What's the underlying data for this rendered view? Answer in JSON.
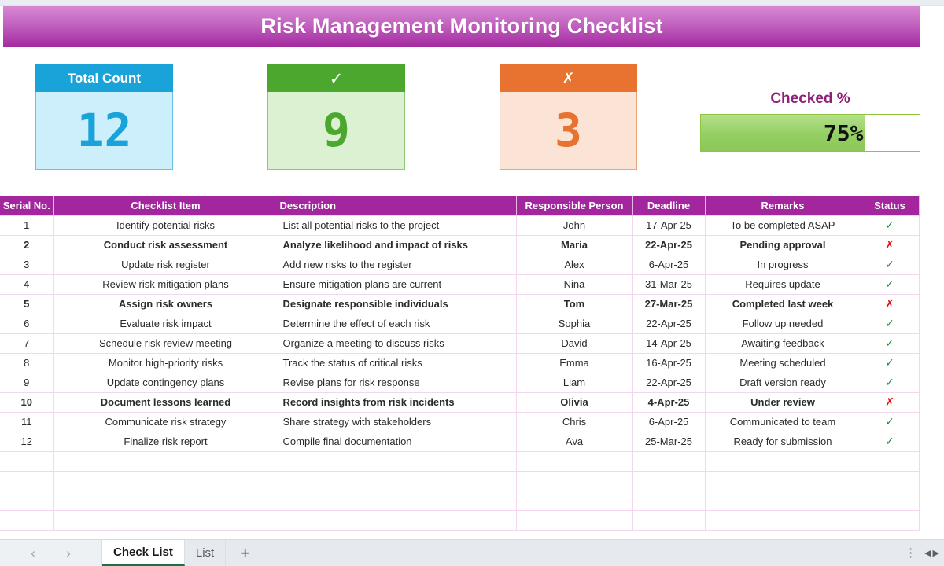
{
  "header": {
    "title": "Risk Management Monitoring Checklist"
  },
  "kpi": {
    "total": {
      "label": "Total Count",
      "value": "12"
    },
    "checked": {
      "label": "✓",
      "value": "9"
    },
    "unchecked": {
      "label": "✗",
      "value": "3"
    }
  },
  "gauge": {
    "label": "Checked %",
    "value": "75%",
    "percent": 75
  },
  "table": {
    "columns": [
      "Serial No.",
      "Checklist Item",
      "Description",
      "Responsible Person",
      "Deadline",
      "Remarks",
      "Status"
    ],
    "rows": [
      {
        "serial": "1",
        "item": "Identify potential risks",
        "desc": "List all potential risks to the project",
        "person": "John",
        "deadline": "17-Apr-25",
        "remarks": "To be completed ASAP",
        "status": "✓",
        "flagged": false
      },
      {
        "serial": "2",
        "item": "Conduct risk assessment",
        "desc": "Analyze likelihood and impact of risks",
        "person": "Maria",
        "deadline": "22-Apr-25",
        "remarks": "Pending approval",
        "status": "✗",
        "flagged": true
      },
      {
        "serial": "3",
        "item": "Update risk register",
        "desc": "Add new risks to the register",
        "person": "Alex",
        "deadline": "6-Apr-25",
        "remarks": "In progress",
        "status": "✓",
        "flagged": false
      },
      {
        "serial": "4",
        "item": "Review risk mitigation plans",
        "desc": "Ensure mitigation plans are current",
        "person": "Nina",
        "deadline": "31-Mar-25",
        "remarks": "Requires update",
        "status": "✓",
        "flagged": false
      },
      {
        "serial": "5",
        "item": "Assign risk owners",
        "desc": "Designate responsible individuals",
        "person": "Tom",
        "deadline": "27-Mar-25",
        "remarks": "Completed last week",
        "status": "✗",
        "flagged": true
      },
      {
        "serial": "6",
        "item": "Evaluate risk impact",
        "desc": "Determine the effect of each risk",
        "person": "Sophia",
        "deadline": "22-Apr-25",
        "remarks": "Follow up needed",
        "status": "✓",
        "flagged": false
      },
      {
        "serial": "7",
        "item": "Schedule risk review meeting",
        "desc": "Organize a meeting to discuss risks",
        "person": "David",
        "deadline": "14-Apr-25",
        "remarks": "Awaiting feedback",
        "status": "✓",
        "flagged": false
      },
      {
        "serial": "8",
        "item": "Monitor high-priority risks",
        "desc": "Track the status of critical risks",
        "person": "Emma",
        "deadline": "16-Apr-25",
        "remarks": "Meeting scheduled",
        "status": "✓",
        "flagged": false
      },
      {
        "serial": "9",
        "item": "Update contingency plans",
        "desc": "Revise plans for risk response",
        "person": "Liam",
        "deadline": "22-Apr-25",
        "remarks": "Draft version ready",
        "status": "✓",
        "flagged": false
      },
      {
        "serial": "10",
        "item": "Document lessons learned",
        "desc": "Record insights from risk incidents",
        "person": "Olivia",
        "deadline": "4-Apr-25",
        "remarks": "Under review",
        "status": "✗",
        "flagged": true
      },
      {
        "serial": "11",
        "item": "Communicate risk strategy",
        "desc": "Share strategy with stakeholders",
        "person": "Chris",
        "deadline": "6-Apr-25",
        "remarks": "Communicated to team",
        "status": "✓",
        "flagged": false
      },
      {
        "serial": "12",
        "item": "Finalize risk report",
        "desc": "Compile final documentation",
        "person": "Ava",
        "deadline": "25-Mar-25",
        "remarks": "Ready for submission",
        "status": "✓",
        "flagged": false
      }
    ],
    "empty_row_count": 4
  },
  "bottom": {
    "prev_arrow": "‹",
    "next_arrow": "›",
    "tabs": [
      {
        "label": "Check List",
        "active": true
      },
      {
        "label": "List",
        "active": false
      }
    ],
    "add_sheet": "+",
    "kebab": "⋮",
    "scroll_left": "◀",
    "scroll_right": "▶"
  },
  "colors": {
    "banner_top": "#d98ad3",
    "banner_bottom": "#a32a9f",
    "header_purple": "#a3269e",
    "blue": "#1aa3d9",
    "green": "#4ba72d",
    "orange": "#e8722f",
    "gauge_green": "#8cc857",
    "flag_red": "#ef0d0d",
    "tick_green": "#1e8a36",
    "cross_red": "#e30b13",
    "gridline_pink": "#f3d7ef"
  }
}
